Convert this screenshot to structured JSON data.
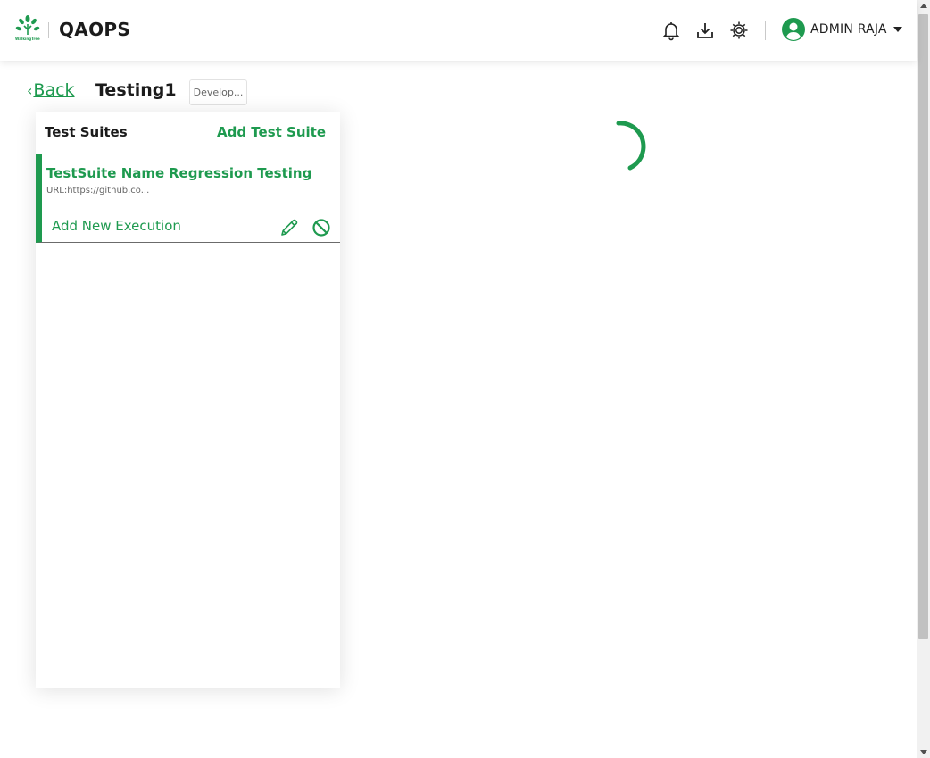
{
  "header": {
    "logo_text": "WalkingTree",
    "app_name": "QAOPS",
    "icons": [
      "bell-icon",
      "download-icon",
      "settings-icon"
    ],
    "user": {
      "name": "ADMIN RAJA",
      "avatar_icon": "user-circle-icon",
      "menu_icon": "caret-down-icon"
    }
  },
  "page": {
    "back_label": "Back",
    "project_title": "Testing1",
    "environment_badge": "Develop..."
  },
  "suites_panel": {
    "title": "Test Suites",
    "add_label": "Add Test Suite",
    "items": [
      {
        "name_label": "TestSuite Name",
        "name_value": "Regression Testing",
        "url": "URL:https://github.co...",
        "add_execution_label": "Add New Execution",
        "actions": [
          "edit-pencil-icon",
          "disable-icon"
        ]
      }
    ]
  },
  "loading": {
    "icon": "loading-spinner"
  },
  "colors": {
    "accent": "#1e9a4f",
    "text": "#1b1b1b",
    "muted": "#666666"
  }
}
